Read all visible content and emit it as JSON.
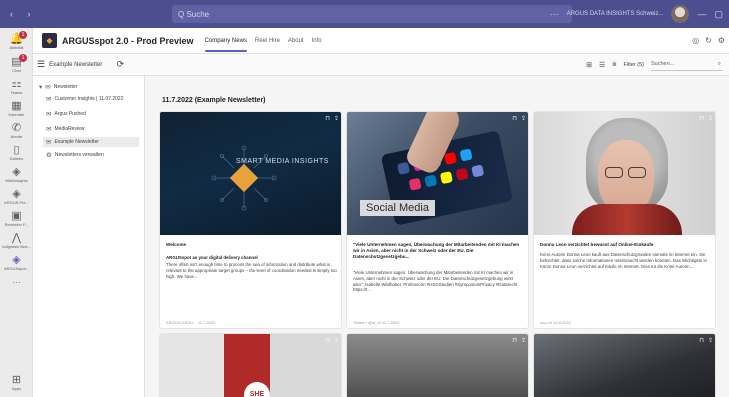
{
  "titlebar": {
    "search_placeholder": "Q Suche",
    "account": "ARGUS DATA INSIGHTS Schweiz..."
  },
  "rail": {
    "items": [
      {
        "label": "Aktivität",
        "badge": "1"
      },
      {
        "label": "Chat",
        "badge": "1"
      },
      {
        "label": "Teams",
        "badge": ""
      },
      {
        "label": "Kalender",
        "badge": ""
      },
      {
        "label": "Anrufe",
        "badge": ""
      },
      {
        "label": "Dateien",
        "badge": ""
      },
      {
        "label": "Wiki/insights",
        "badge": ""
      },
      {
        "label": "ARGUS Pre...",
        "badge": ""
      },
      {
        "label": "Reminder F...",
        "badge": ""
      },
      {
        "label": "Aufgaben Bea...",
        "badge": ""
      },
      {
        "label": "ARGUSspot...",
        "badge": ""
      },
      {
        "label": "Apps",
        "badge": ""
      }
    ]
  },
  "app": {
    "title": "ARGUSspot 2.0 - Prod Preview",
    "tabs": [
      "Company News",
      "Reel Hire",
      "About",
      "Info"
    ]
  },
  "toolbar": {
    "newsletter_label": "Example Newsletter",
    "filter_label": "Filter (5)",
    "search_placeholder": "Suchen..."
  },
  "tree": {
    "root": "Newsletter",
    "items": [
      "Customer Insights | 11.07.2022",
      "Argus Pushed",
      "MediaReview",
      "Example Newsletter",
      "Newsletters verwalten"
    ]
  },
  "main": {
    "date_heading": "11.7.2022 (Example Newsletter)",
    "cards": [
      {
        "image_caption": "SMART MEDIA INSIGHTS",
        "title": "Welcome",
        "subtitle": "ARGUSspot as your digital delivery channel",
        "text": "There often isn't enough time to process the sea of information and distribute what is relevant to the appropriate target groups – the level of coordination needed is simply too high. We have...",
        "meta": "ARGUS DATA I...    11.7.2022"
      },
      {
        "image_caption": "Social Media",
        "title": "\"Viele Unternehmen sagen, Überwachung der Mitarbeitenden mit KI machen wir in Asien, aber nicht in der Schweiz oder der EU. Die Datenschutzgesetzgebu...",
        "subtitle": "",
        "text": "\"Viele Unternehmen sagen, Überwachung der Mitarbeitenden mit KI machen wir in Asien, aber nicht in der Schweiz oder der EU. Die Datenschutzgesetzgebung wirkt also\", Isabelle Wildhaber, Professorin #HSGStudien #SymposiumPrivacy #Datarecht https://t...",
        "meta": "Twitter / @st_th    11.7.2022"
      },
      {
        "image_caption": "",
        "title": "Donna Leon verzichtet bewusst auf Online-Einkäufe",
        "subtitle": "",
        "text": "Krimi-Autorin Donna Leon kauft aus Datenschutzgründen niemals im Internet ein. Sie befürchtet, dass solche Informationen missbraucht werden könnten. Das Wichtigste in Kürze Donna Leon verzichtet auf Käufe im Internet. Dies tut die Krimi-Autorin...",
        "meta": "nau.ch    14.8.2022"
      }
    ],
    "row2_captions": [
      "SHE",
      "",
      ""
    ]
  }
}
